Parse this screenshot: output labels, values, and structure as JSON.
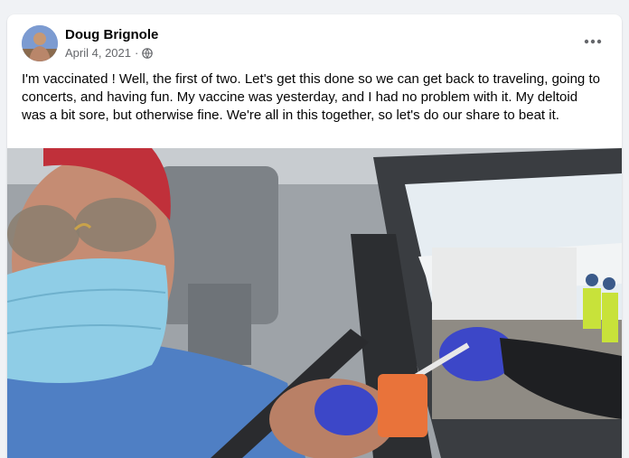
{
  "post": {
    "author": "Doug Brignole",
    "date": "April 4, 2021",
    "separator": "·",
    "privacy_icon": "globe-icon",
    "more_icon": "more-options-icon",
    "text": "I'm vaccinated ! Well, the first of two. Let's get this done so we can get back to traveling, going to concerts, and having fun. My vaccine was yesterday, and I had no problem with it. My deltoid was a bit sore, but otherwise fine. We're all in this together, so let's do our share to beat it."
  },
  "colors": {
    "page_bg": "#f0f2f5",
    "card_bg": "#ffffff",
    "author_text": "#050505",
    "meta_text": "#65676b"
  }
}
